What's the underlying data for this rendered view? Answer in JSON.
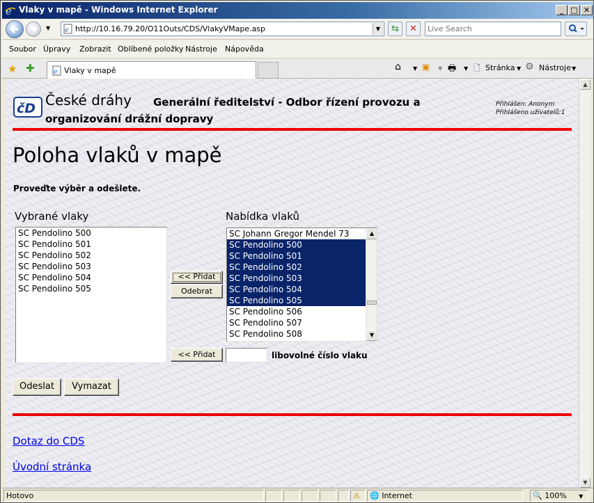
{
  "window": {
    "title": "Vlaky v mapě - Windows Internet Explorer",
    "minimize": "_",
    "maximize": "□",
    "close": "✕"
  },
  "address": {
    "url": "http://10.16.79.20/O11Outs/CDS/VlakyVMape.asp",
    "search_placeholder": "Live Search"
  },
  "menu": [
    "Soubor",
    "Úpravy",
    "Zobrazit",
    "Oblíbené položky",
    "Nástroje",
    "Nápověda"
  ],
  "tab": {
    "title": "Vlaky v mapě"
  },
  "commandbar": {
    "page_label": "Stránka",
    "tools_label": "Nástroje"
  },
  "header": {
    "company": "České dráhy",
    "subtitle_line1": "Generální ředitelství - Odbor řízení provozu a",
    "subtitle_line2": "organizování drážní dopravy",
    "login_user": "Přihlášen: Anonym",
    "login_count": "Přihlášeno uživatelů:1"
  },
  "main": {
    "title": "Poloha vlaků v mapě",
    "instruction": "Proveďte výběr a odešlete.",
    "selected_label": "Vybrané vlaky",
    "offer_label": "Nabídka vlaků",
    "selected_trains": [
      "SC Pendolino 500",
      "SC Pendolino 501",
      "SC Pendolino 502",
      "SC Pendolino 503",
      "SC Pendolino 504",
      "SC Pendolino 505"
    ],
    "offered_trains": [
      {
        "name": "SC Johann Gregor Mendel 73",
        "selected": false
      },
      {
        "name": "SC Pendolino 500",
        "selected": true
      },
      {
        "name": "SC Pendolino 501",
        "selected": true
      },
      {
        "name": "SC Pendolino 502",
        "selected": true
      },
      {
        "name": "SC Pendolino 503",
        "selected": true
      },
      {
        "name": "SC Pendolino 504",
        "selected": true
      },
      {
        "name": "SC Pendolino 505",
        "selected": true
      },
      {
        "name": "SC Pendolino 506",
        "selected": false
      },
      {
        "name": "SC Pendolino 507",
        "selected": false
      },
      {
        "name": "SC Pendolino 508",
        "selected": false
      }
    ],
    "add_button": "<< Přidat",
    "remove_button": "Odebrat",
    "add_number_button": "<< Přidat",
    "train_number_value": "",
    "train_number_label": "libovolné číslo vlaku",
    "submit_button": "Odeslat",
    "clear_button": "Vymazat"
  },
  "links": {
    "query": "Dotaz do CDS",
    "home": "Úvodní stránka"
  },
  "status": {
    "text": "Hotovo",
    "zone": "Internet",
    "zoom": "100%"
  }
}
